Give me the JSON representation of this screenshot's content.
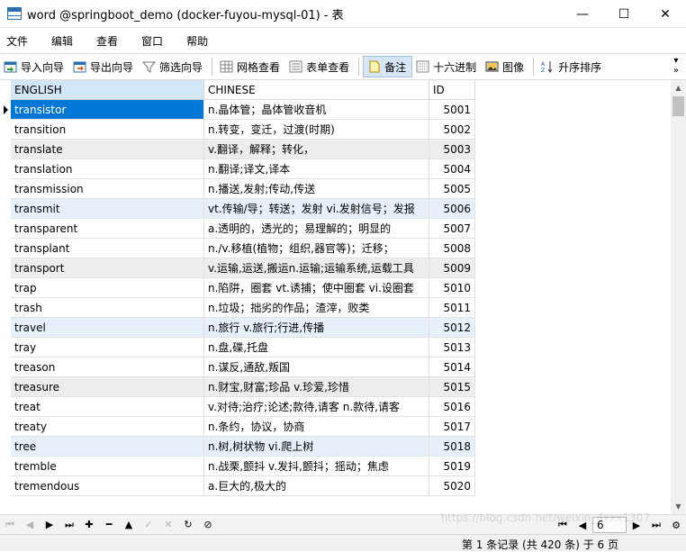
{
  "window": {
    "title": "word @springboot_demo (docker-fuyou-mysql-01) - 表",
    "minimize": "—",
    "maximize": "☐",
    "close": "✕"
  },
  "menu": [
    "文件",
    "编辑",
    "查看",
    "窗口",
    "帮助"
  ],
  "toolbar": {
    "import_wizard": "导入向导",
    "export_wizard": "导出向导",
    "filter_wizard": "筛选向导",
    "grid_view": "网格查看",
    "form_view": "表单查看",
    "memo": "备注",
    "hex": "十六进制",
    "image": "图像",
    "sort_asc": "升序排序"
  },
  "grid": {
    "columns": [
      "ENGLISH",
      "CHINESE",
      "ID"
    ],
    "rows": [
      {
        "english": "transistor",
        "chinese": "n.晶体管；晶体管收音机",
        "id": "5001"
      },
      {
        "english": "transition",
        "chinese": "n.转变，变迁，过渡(时期)",
        "id": "5002"
      },
      {
        "english": "translate",
        "chinese": "v.翻译，解释；转化，",
        "id": "5003"
      },
      {
        "english": "translation",
        "chinese": "n.翻译;译文,译本",
        "id": "5004"
      },
      {
        "english": "transmission",
        "chinese": "n.播送,发射;传动,传送",
        "id": "5005"
      },
      {
        "english": "transmit",
        "chinese": "vt.传输/导；转送；发射 vi.发射信号；发报",
        "id": "5006"
      },
      {
        "english": "transparent",
        "chinese": "a.透明的，透光的；易理解的；明显的",
        "id": "5007"
      },
      {
        "english": "transplant",
        "chinese": "n./v.移植(植物；组织,器官等)；迁移；",
        "id": "5008"
      },
      {
        "english": "transport",
        "chinese": "v.运输,运送,搬运n.运输;运输系统,运载工具",
        "id": "5009"
      },
      {
        "english": "trap",
        "chinese": "n.陷阱，圈套 vt.诱捕；使中圈套 vi.设圈套",
        "id": "5010"
      },
      {
        "english": "trash",
        "chinese": "n.垃圾；拙劣的作品；渣滓，败类",
        "id": "5011"
      },
      {
        "english": "travel",
        "chinese": "n.旅行 v.旅行;行进,传播",
        "id": "5012"
      },
      {
        "english": "tray",
        "chinese": "n.盘,碟,托盘",
        "id": "5013"
      },
      {
        "english": "treason",
        "chinese": "n.谋反,通敌,叛国",
        "id": "5014"
      },
      {
        "english": "treasure",
        "chinese": "n.财宝,财富;珍品 v.珍爱,珍惜",
        "id": "5015"
      },
      {
        "english": "treat",
        "chinese": "v.对待;治疗;论述;款待,请客 n.款待,请客",
        "id": "5016"
      },
      {
        "english": "treaty",
        "chinese": "n.条约，协议，协商",
        "id": "5017"
      },
      {
        "english": "tree",
        "chinese": "n.树,树状物  vi.爬上树",
        "id": "5018"
      },
      {
        "english": "tremble",
        "chinese": "n.战栗,颤抖 v.发抖,颤抖；摇动；焦虑",
        "id": "5019"
      },
      {
        "english": "tremendous",
        "chinese": "a.巨大的,极大的",
        "id": "5020"
      }
    ]
  },
  "pager": {
    "page": "6"
  },
  "status": {
    "text": "第 1 条记录 (共 420 条) 于 6 页"
  },
  "colors": {
    "selection": "#0078d7",
    "header_selected": "#d3e6f7",
    "alt_row": "#ededed",
    "highlight_row": "#e7f0fa"
  },
  "watermark": "https://blog.csdn.net/weixin_4xxx1307"
}
